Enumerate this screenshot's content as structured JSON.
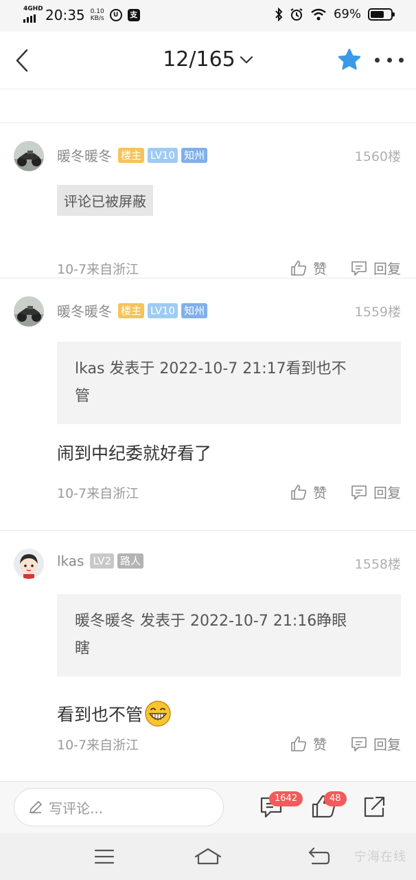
{
  "status_bar": {
    "network": "4GHD",
    "time": "20:35",
    "speed_value": "0.10",
    "speed_unit": "KB/s",
    "battery_text": "69%",
    "battery_level": 0.69
  },
  "header": {
    "page_counter": "12/165"
  },
  "posts": [
    {
      "username": "暖冬暖冬",
      "tags": [
        "楼主",
        "LV10",
        "知州"
      ],
      "floor": "1560楼",
      "blocked_text": "评论已被屏蔽",
      "meta": "10-7来自浙江",
      "like_label": "赞",
      "reply_label": "回复"
    },
    {
      "username": "暖冬暖冬",
      "tags": [
        "楼主",
        "LV10",
        "知州"
      ],
      "floor": "1559楼",
      "quote": "lkas 发表于 2022-10-7 21:17看到也不管",
      "quote_line1": "lkas 发表于 2022-10-7 21:17看到也不",
      "quote_line2": "管",
      "body": "闹到中纪委就好看了",
      "meta": "10-7来自浙江",
      "like_label": "赞",
      "reply_label": "回复"
    },
    {
      "username": "lkas",
      "tags": [
        "LV2",
        "路人"
      ],
      "floor": "1558楼",
      "quote_line1": "暖冬暖冬 发表于 2022-10-7 21:16睁眼",
      "quote_line2": "瞎",
      "body": "看到也不管",
      "meta": "10-7来自浙江",
      "like_label": "赞",
      "reply_label": "回复"
    }
  ],
  "bottom_bar": {
    "comment_placeholder": "写评论...",
    "comment_count": "1642",
    "like_count": "48"
  },
  "watermark": "宁海在线",
  "colors": {
    "accent_star": "#3a9ae6",
    "tag_host": "#f6c35a",
    "tag_level": "#9ecbf3",
    "tag_place": "#7fb0ea",
    "badge": "#f25b5b"
  }
}
